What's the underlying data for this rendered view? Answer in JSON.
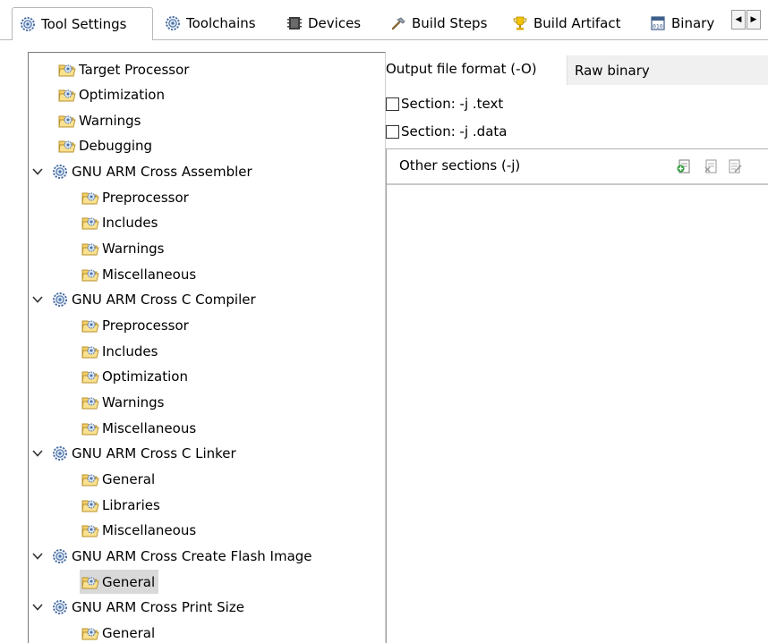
{
  "tabs": [
    {
      "label": "Tool Settings",
      "icon": "gear-icon",
      "active": true
    },
    {
      "label": "Toolchains",
      "icon": "gear-icon"
    },
    {
      "label": "Devices",
      "icon": "chip-icon"
    },
    {
      "label": "Build Steps",
      "icon": "hammer-icon"
    },
    {
      "label": "Build Artifact",
      "icon": "trophy-icon"
    },
    {
      "label": "Binary",
      "icon": "binary-file-icon"
    }
  ],
  "tab_scroll": {
    "left": "◀",
    "right": "▶"
  },
  "tree": [
    {
      "label": "Target Processor",
      "level": 1,
      "icon": "folder-tool-icon"
    },
    {
      "label": "Optimization",
      "level": 1,
      "icon": "folder-tool-icon"
    },
    {
      "label": "Warnings",
      "level": 1,
      "icon": "folder-tool-icon"
    },
    {
      "label": "Debugging",
      "level": 1,
      "icon": "folder-tool-icon"
    },
    {
      "label": "GNU ARM Cross Assembler",
      "level": 0,
      "icon": "gear-icon",
      "expanded": true
    },
    {
      "label": "Preprocessor",
      "level": 2,
      "icon": "folder-tool-icon"
    },
    {
      "label": "Includes",
      "level": 2,
      "icon": "folder-tool-icon"
    },
    {
      "label": "Warnings",
      "level": 2,
      "icon": "folder-tool-icon"
    },
    {
      "label": "Miscellaneous",
      "level": 2,
      "icon": "folder-tool-icon"
    },
    {
      "label": "GNU ARM Cross C Compiler",
      "level": 0,
      "icon": "gear-icon",
      "expanded": true
    },
    {
      "label": "Preprocessor",
      "level": 2,
      "icon": "folder-tool-icon"
    },
    {
      "label": "Includes",
      "level": 2,
      "icon": "folder-tool-icon"
    },
    {
      "label": "Optimization",
      "level": 2,
      "icon": "folder-tool-icon"
    },
    {
      "label": "Warnings",
      "level": 2,
      "icon": "folder-tool-icon"
    },
    {
      "label": "Miscellaneous",
      "level": 2,
      "icon": "folder-tool-icon"
    },
    {
      "label": "GNU ARM Cross C Linker",
      "level": 0,
      "icon": "gear-icon",
      "expanded": true
    },
    {
      "label": "General",
      "level": 2,
      "icon": "folder-tool-icon"
    },
    {
      "label": "Libraries",
      "level": 2,
      "icon": "folder-tool-icon"
    },
    {
      "label": "Miscellaneous",
      "level": 2,
      "icon": "folder-tool-icon"
    },
    {
      "label": "GNU ARM Cross Create Flash Image",
      "level": 0,
      "icon": "gear-icon",
      "expanded": true
    },
    {
      "label": "General",
      "level": 2,
      "icon": "folder-tool-icon",
      "selected": true
    },
    {
      "label": "GNU ARM Cross Print Size",
      "level": 0,
      "icon": "gear-icon",
      "expanded": true
    },
    {
      "label": "General",
      "level": 2,
      "icon": "folder-tool-icon"
    }
  ],
  "settings": {
    "output_format_label": "Output file format (-O)",
    "output_format_value": "Raw binary",
    "section_text_label": "Section: -j .text",
    "section_text_checked": false,
    "section_data_label": "Section: -j .data",
    "section_data_checked": false,
    "other_sections_label": "Other sections (-j)",
    "list_tools": [
      "add-icon",
      "delete-icon",
      "edit-icon"
    ]
  },
  "colors": {
    "selection": "#d9d9d9",
    "folder": "#f0c040",
    "gear": "#4a6fa5",
    "accent_green": "#2e9e3e"
  }
}
